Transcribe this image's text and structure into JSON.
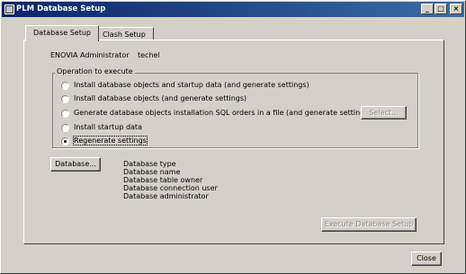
{
  "window": {
    "title": "PLM Database Setup"
  },
  "titlebar_buttons": {
    "minimize": "_",
    "maximize": "□",
    "close": "×"
  },
  "tabs": [
    {
      "label": "Database Setup",
      "active": true
    },
    {
      "label": "Clash Setup",
      "active": false
    }
  ],
  "admin": {
    "label": "ENOVIA Administrator",
    "value": "techel"
  },
  "operation_group": {
    "title": "Operation to execute",
    "options": [
      {
        "label": "Install database objects and startup data (and generate settings)",
        "selected": false
      },
      {
        "label": "Install database objects (and generate settings)",
        "selected": false
      },
      {
        "label": "Generate database objects installation SQL orders in a file (and generate settings)",
        "selected": false
      },
      {
        "label": "Install startup data",
        "selected": false
      },
      {
        "label": "Regenerate settings",
        "selected": true
      }
    ],
    "select_button": "Select..."
  },
  "database": {
    "button": "Database...",
    "info": [
      "Database type",
      "Database name",
      "Database table owner",
      "Database connection user",
      "Database administrator"
    ]
  },
  "execute_button": "Execute Database Setup",
  "close_button": "Close"
}
